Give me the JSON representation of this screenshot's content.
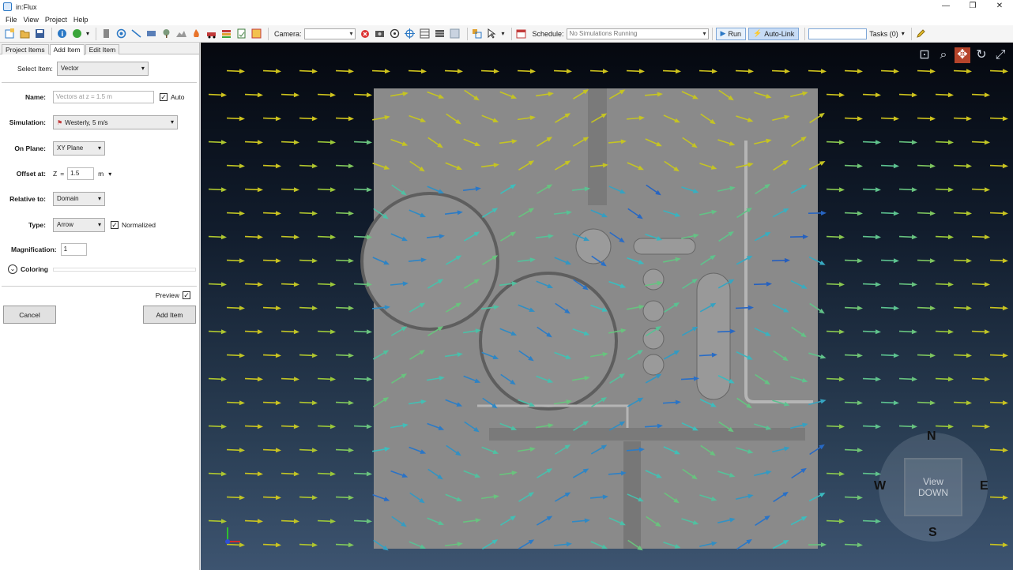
{
  "window": {
    "title": "in:Flux",
    "min": "—",
    "max": "❐",
    "close": "✕"
  },
  "menu": [
    "File",
    "View",
    "Project",
    "Help"
  ],
  "toolbar": {
    "camera_label": "Camera:",
    "camera_value": "",
    "schedule_label": "Schedule:",
    "schedule_value": "No Simulations Running",
    "run_label": "Run",
    "autolink_label": "Auto-Link",
    "tasks_label": "Tasks (0)",
    "search_value": ""
  },
  "tabs": [
    "Project Items",
    "Add Item",
    "Edit Item"
  ],
  "form": {
    "select_item_label": "Select Item:",
    "select_item_value": "Vector",
    "name_label": "Name:",
    "name_placeholder": "Vectors at z = 1.5 m",
    "auto_label": "Auto",
    "auto_checked": "✓",
    "simulation_label": "Simulation:",
    "simulation_value": "Westerly, 5 m/s",
    "on_plane_label": "On Plane:",
    "on_plane_value": "XY Plane",
    "offset_label": "Offset at:",
    "offset_axis": "Z",
    "offset_eq": "=",
    "offset_value": "1.5",
    "offset_unit": "m",
    "relative_label": "Relative to:",
    "relative_value": "Domain",
    "type_label": "Type:",
    "type_value": "Arrow",
    "normalized_label": "Normalized",
    "normalized_checked": "✓",
    "magnification_label": "Magnification:",
    "magnification_value": "1",
    "coloring_label": "Coloring",
    "preview_label": "Preview",
    "preview_checked": "✓",
    "cancel_label": "Cancel",
    "add_label": "Add Item"
  },
  "viewport": {
    "compass": {
      "n": "N",
      "s": "S",
      "e": "E",
      "w": "W",
      "view": "View",
      "mode": "DOWN"
    }
  },
  "colors": {
    "accent": "#2b78c5",
    "ground": "#8a8a8a",
    "arrow_fast": "#d4c21a",
    "arrow_slow": "#1e2d9a"
  }
}
